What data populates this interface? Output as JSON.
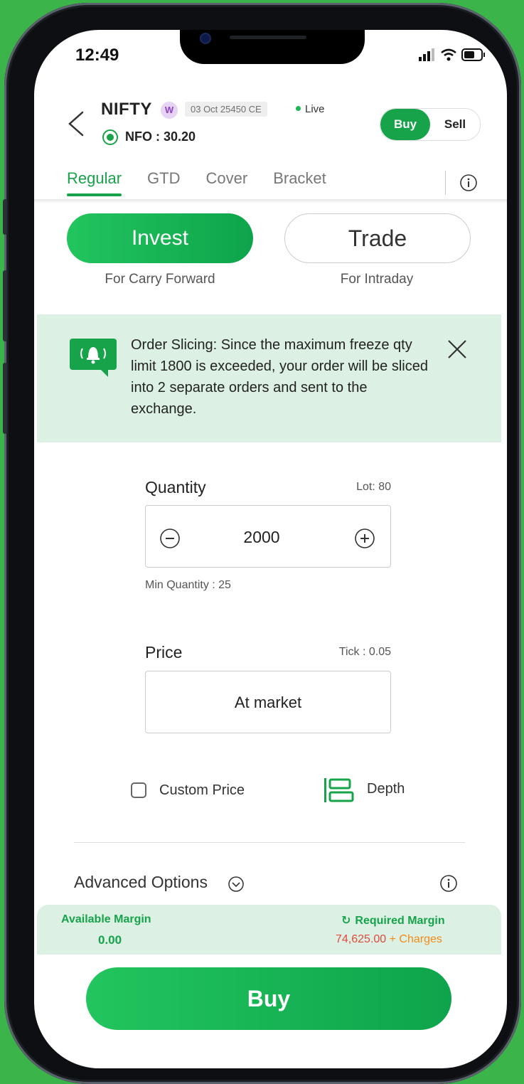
{
  "status_bar": {
    "time": "12:49"
  },
  "header": {
    "symbol": "NIFTY",
    "series_badge": "W",
    "contract": "03 Oct 25450 CE",
    "live_label": "Live",
    "exchange_price": "NFO : 30.20",
    "buy_label": "Buy",
    "sell_label": "Sell"
  },
  "tabs": [
    {
      "label": "Regular",
      "active": true
    },
    {
      "label": "GTD",
      "active": false
    },
    {
      "label": "Cover",
      "active": false
    },
    {
      "label": "Bracket",
      "active": false
    }
  ],
  "product": {
    "invest_label": "Invest",
    "invest_sub": "For Carry Forward",
    "trade_label": "Trade",
    "trade_sub": "For Intraday"
  },
  "banner": {
    "text": "Order Slicing: Since the maximum freeze qty limit 1800 is exceeded, your order will be sliced into 2 separate orders and sent to the exchange."
  },
  "quantity": {
    "label": "Quantity",
    "lot": "Lot: 80",
    "value": "2000",
    "min": "Min Quantity : 25"
  },
  "price": {
    "label": "Price",
    "tick": "Tick : 0.05",
    "value": "At market"
  },
  "options": {
    "custom_price_label": "Custom Price",
    "depth_label": "Depth",
    "advanced_label": "Advanced Options"
  },
  "margin": {
    "available_label": "Available Margin",
    "available_value": "0.00",
    "required_label": "Required Margin",
    "required_value": "74,625.00",
    "charges_label": "+ Charges"
  },
  "cta": {
    "buy_label": "Buy"
  },
  "colors": {
    "brand_green": "#16a34a",
    "banner_bg": "#dcf1e3",
    "required_value": "#e04a3a",
    "charges": "#f28a1a",
    "page_bg": "#3bb54a"
  }
}
